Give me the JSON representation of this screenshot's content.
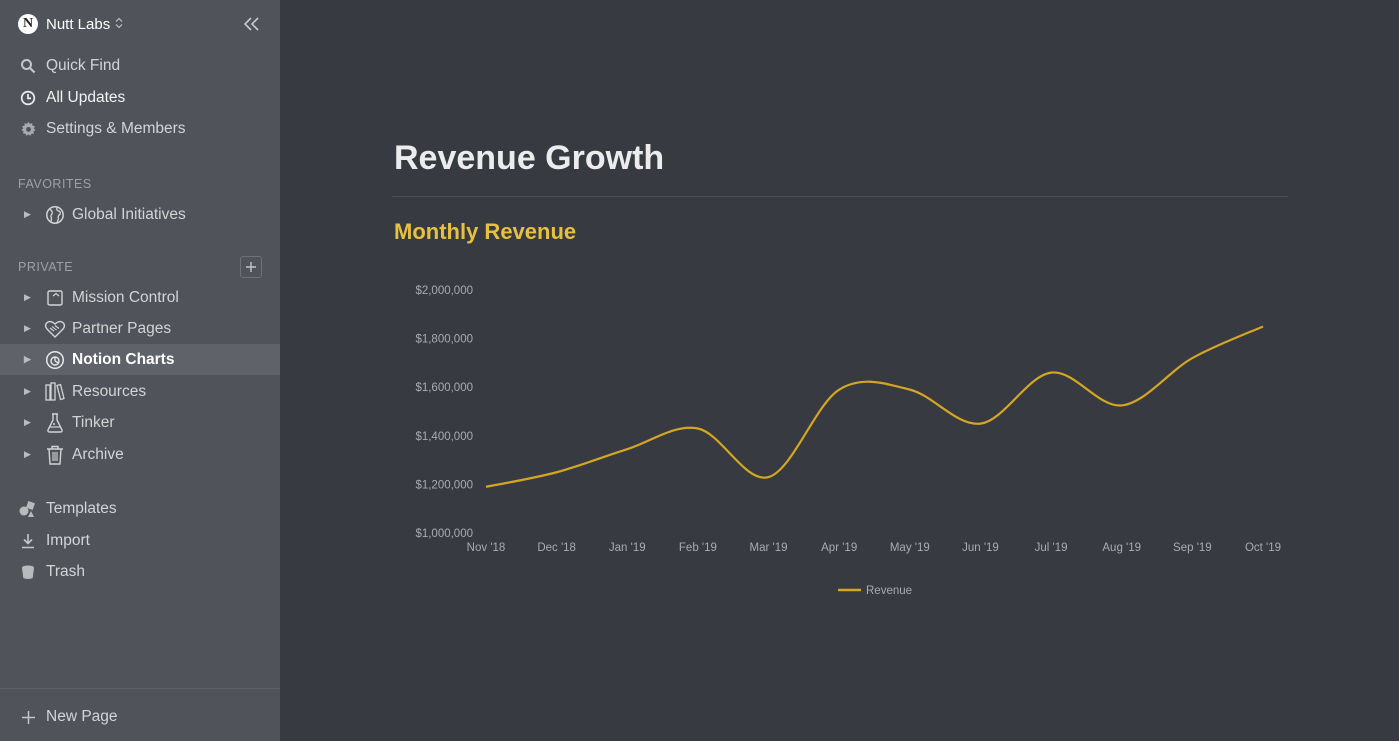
{
  "workspace": {
    "logo_letter": "N",
    "name": "Nutt Labs",
    "switch_icon": "chevron-updown-icon",
    "collapse_icon": "double-chevron-left-icon"
  },
  "nav": {
    "quick_find": "Quick Find",
    "all_updates": "All Updates",
    "settings": "Settings & Members"
  },
  "sections": {
    "favorites": "FAVORITES",
    "private": "PRIVATE"
  },
  "favorites": [
    {
      "label": "Global Initiatives",
      "icon": "globe-icon"
    }
  ],
  "private_pages": [
    {
      "label": "Mission Control",
      "icon": "window-icon",
      "active": false
    },
    {
      "label": "Partner Pages",
      "icon": "handshake-heart-icon",
      "active": false
    },
    {
      "label": "Notion Charts",
      "icon": "chart-pie-icon",
      "active": true
    },
    {
      "label": "Resources",
      "icon": "books-icon",
      "active": false
    },
    {
      "label": "Tinker",
      "icon": "flask-icon",
      "active": false
    },
    {
      "label": "Archive",
      "icon": "trash-can-icon",
      "active": false
    }
  ],
  "footer_nav": {
    "templates": "Templates",
    "import": "Import",
    "trash": "Trash",
    "new_page": "New Page"
  },
  "page": {
    "title": "Revenue Growth",
    "section_title": "Monthly Revenue"
  },
  "colors": {
    "sidebar_bg": "#505359",
    "main_bg": "#373a41",
    "accent": "#e6c03e",
    "line": "#d4a622"
  },
  "chart_data": {
    "type": "line",
    "categories": [
      "Nov '18",
      "Dec '18",
      "Jan '19",
      "Feb '19",
      "Mar '19",
      "Apr '19",
      "May '19",
      "Jun '19",
      "Jul '19",
      "Aug '19",
      "Sep '19",
      "Oct '19"
    ],
    "series": [
      {
        "name": "Revenue",
        "values": [
          1190000,
          1250000,
          1345000,
          1430000,
          1230000,
          1590000,
          1590000,
          1450000,
          1660000,
          1525000,
          1720000,
          1850000
        ]
      }
    ],
    "ylim": [
      1000000,
      2000000
    ],
    "yticks": [
      "$2,000,000",
      "$1,800,000",
      "$1,600,000",
      "$1,400,000",
      "$1,200,000",
      "$1,000,000"
    ],
    "ytick_values": [
      2000000,
      1800000,
      1600000,
      1400000,
      1200000,
      1000000
    ],
    "legend_position": "bottom",
    "grid": false,
    "smooth": true
  }
}
